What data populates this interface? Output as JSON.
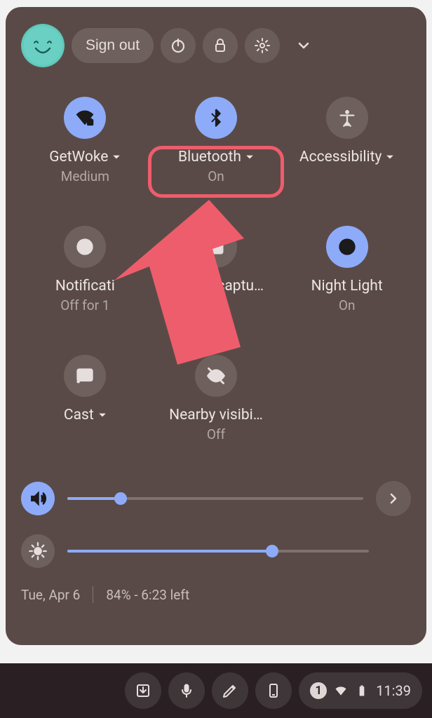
{
  "header": {
    "sign_out": "Sign out"
  },
  "tiles": {
    "wifi": {
      "label": "GetWoke",
      "sub": "Medium",
      "active": true,
      "expandable": true
    },
    "bt": {
      "label": "Bluetooth",
      "sub": "On",
      "active": true,
      "expandable": true
    },
    "a11y": {
      "label": "Accessibility",
      "sub": "",
      "active": false,
      "expandable": true
    },
    "notif": {
      "label": "Notificati",
      "sub": "Off for 1",
      "active": false,
      "expandable": false
    },
    "capture": {
      "label": "Screen captu…",
      "sub": "",
      "active": false,
      "expandable": false
    },
    "night": {
      "label": "Night Light",
      "sub": "On",
      "active": true,
      "expandable": false
    },
    "cast": {
      "label": "Cast",
      "sub": "",
      "active": false,
      "expandable": true
    },
    "nearby": {
      "label": "Nearby visibi…",
      "sub": "Off",
      "active": false,
      "expandable": false
    }
  },
  "sliders": {
    "volume_pct": 18,
    "brightness_pct": 68
  },
  "footer": {
    "date": "Tue, Apr 6",
    "battery_info": "84% - 6:23 left"
  },
  "taskbar": {
    "notif_count": "1",
    "time": "11:39"
  }
}
